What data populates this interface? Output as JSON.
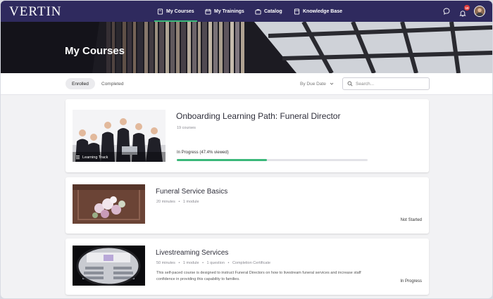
{
  "app": {
    "logo": "VERTIN"
  },
  "nav": {
    "items": [
      {
        "label": "My Courses"
      },
      {
        "label": "My Trainings"
      },
      {
        "label": "Catalog"
      },
      {
        "label": "Knowledge Base"
      }
    ],
    "notification_count": "10"
  },
  "hero": {
    "title": "My Courses"
  },
  "filters": {
    "tabs": [
      {
        "label": "Enrolled"
      },
      {
        "label": "Completed"
      }
    ],
    "sort_label": "By Due Date",
    "search_placeholder": "Search..."
  },
  "courses": [
    {
      "title": "Onboarding Learning Path: Funeral Director",
      "count": "19 courses",
      "badge": "Learning Track",
      "status": "In Progress (47.4% viewed)",
      "progress_percent": 47.4
    },
    {
      "title": "Funeral Service Basics",
      "meta": [
        "20 minutes",
        "1 module"
      ],
      "status": "Not Started"
    },
    {
      "title": "Livestreaming Services",
      "meta": [
        "50 minutes",
        "1 module",
        "1 question",
        "Completion Certificate"
      ],
      "description": "This self-paced course is designed to instruct Funeral Directors on how to livestream funeral services and increase staff confidence in providing this capability to families.",
      "status": "In Progress"
    }
  ],
  "colors": {
    "nav_bg": "#2f2a5e",
    "accent": "#3bb87a",
    "badge": "#e03a3a"
  }
}
